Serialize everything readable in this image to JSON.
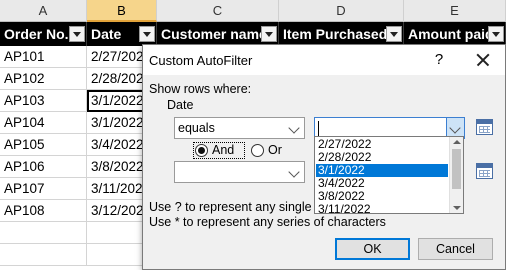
{
  "sheet": {
    "columns": [
      "A",
      "B",
      "C",
      "D",
      "E"
    ],
    "selected_column": "B",
    "headers": [
      "Order No.",
      "Date",
      "Customer name",
      "Item Purchased",
      "Amount paid"
    ],
    "rows": [
      [
        "AP101",
        "2/27/2022"
      ],
      [
        "AP102",
        "2/28/2022"
      ],
      [
        "AP103",
        "3/1/2022"
      ],
      [
        "AP104",
        "3/1/2022"
      ],
      [
        "AP105",
        "3/4/2022"
      ],
      [
        "AP106",
        "3/8/2022"
      ],
      [
        "AP107",
        "3/11/2022"
      ],
      [
        "AP108",
        "3/12/2022"
      ]
    ]
  },
  "dialog": {
    "title": "Custom AutoFilter",
    "help": "?",
    "show_rows_label": "Show rows where:",
    "field_label": "Date",
    "operator1": "equals",
    "value1": "",
    "and_label": "And",
    "or_label": "Or",
    "and_selected": true,
    "operator2": "",
    "dropdown_options": [
      "2/27/2022",
      "2/28/2022",
      "3/1/2022",
      "3/4/2022",
      "3/8/2022",
      "3/11/2022"
    ],
    "dropdown_selected": "3/1/2022",
    "hint1": "Use ? to represent any single charac",
    "hint2": "Use * to represent any series of characters",
    "ok_label": "OK",
    "cancel_label": "Cancel"
  },
  "colors": {
    "selection_blue": "#0078d7",
    "header_black": "#000000",
    "selected_column_highlight": "#f6d58b"
  }
}
